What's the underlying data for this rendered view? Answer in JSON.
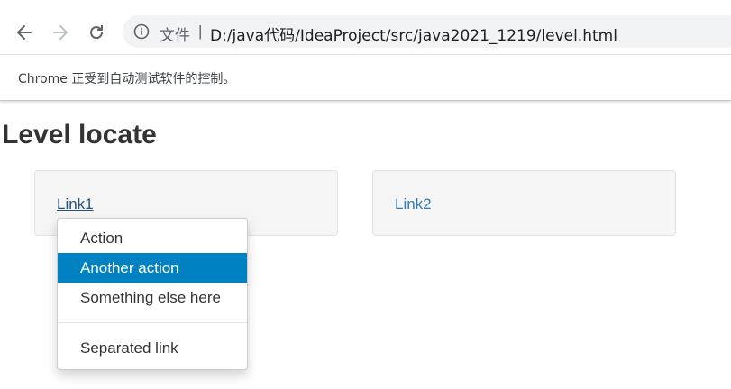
{
  "browser": {
    "security_label": "文件",
    "separator": "|",
    "url": "D:/java代码/IdeaProject/src/java2021_1219/level.html",
    "automation_notice": "Chrome 正受到自动测试软件的控制。",
    "icons": [
      "back-arrow-icon",
      "forward-arrow-icon",
      "reload-icon",
      "info-icon"
    ]
  },
  "page": {
    "title": "Level locate",
    "wells": [
      {
        "link": "Link1"
      },
      {
        "link": "Link2"
      }
    ],
    "dropdown": {
      "items": [
        "Action",
        "Another action",
        "Something else here"
      ],
      "separated_item": "Separated link",
      "active_item": "Another action"
    }
  },
  "colors": {
    "link": "#337ab7",
    "link_hover": "#23527c",
    "dropdown_active_bg": "#0081c2",
    "well_bg": "#f5f5f5"
  }
}
